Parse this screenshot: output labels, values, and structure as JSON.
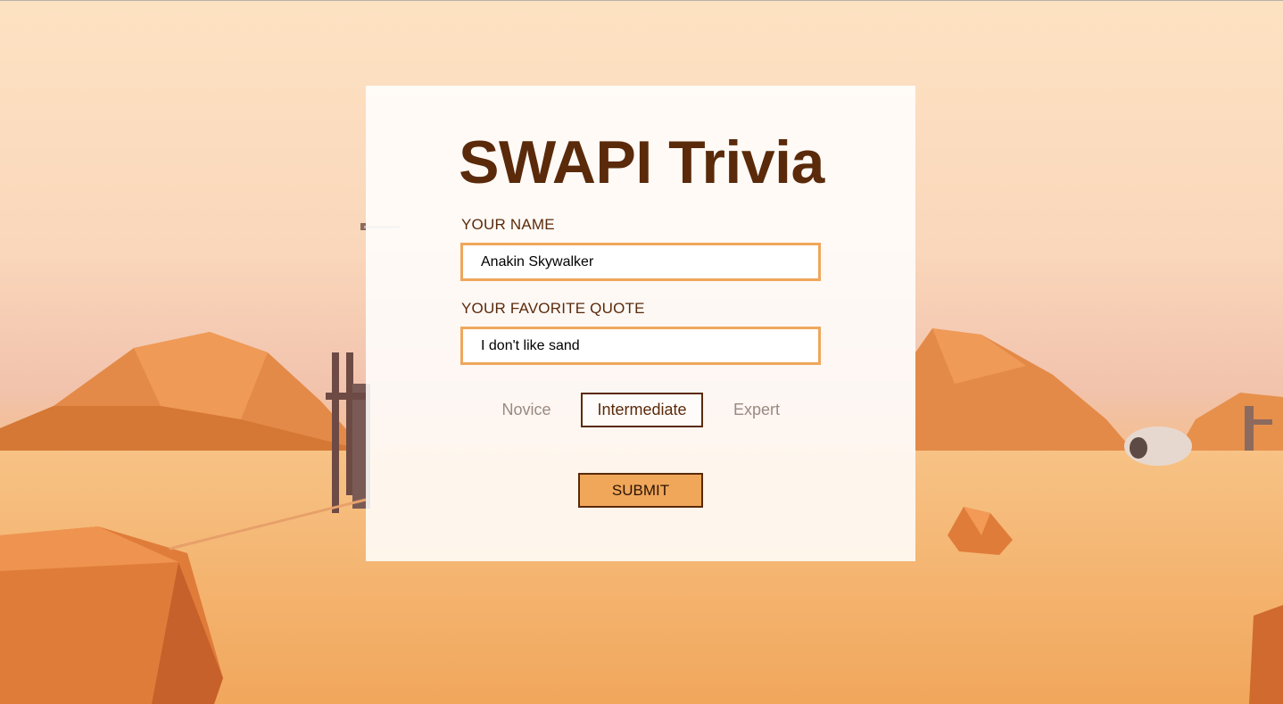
{
  "app": {
    "title": "SWAPI Trivia"
  },
  "form": {
    "name": {
      "label": "YOUR NAME",
      "value": "Anakin Skywalker"
    },
    "quote": {
      "label": "YOUR FAVORITE QUOTE",
      "value": "I don't like sand"
    },
    "difficulty": {
      "options": [
        "Novice",
        "Intermediate",
        "Expert"
      ],
      "selected": "Intermediate"
    },
    "submit_label": "SUBMIT"
  },
  "colors": {
    "title": "#5a2a0a",
    "input_border": "#efa75c",
    "submit_bg": "#f0a75a",
    "selected_border": "#5a2a0a",
    "unselected_text": "#9a8a80"
  }
}
